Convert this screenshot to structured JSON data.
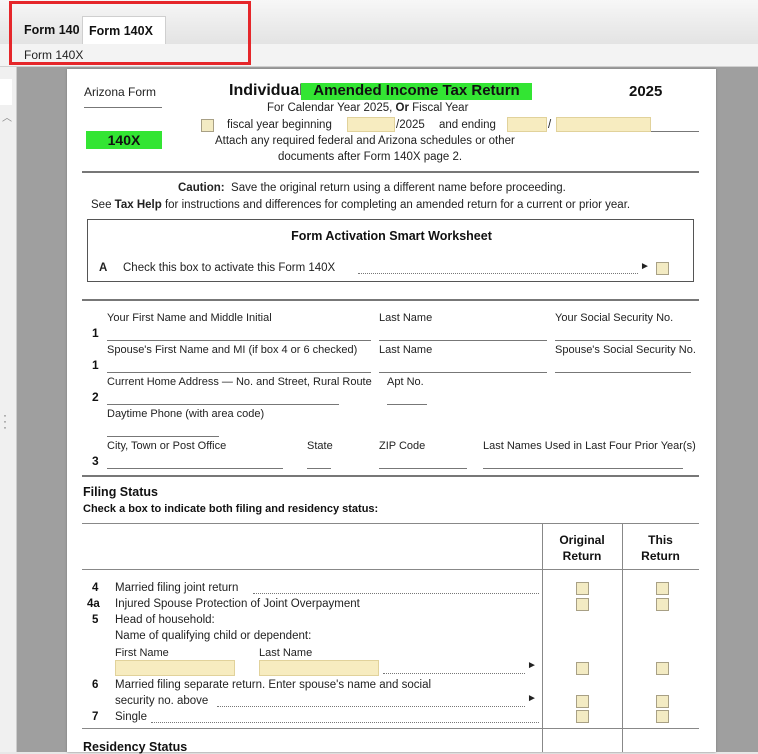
{
  "tabs": [
    "Form 140",
    "Form 140X"
  ],
  "sub_tab": "Form 140X",
  "header": {
    "state_label": "Arizona Form",
    "form_no": "140X",
    "title_prefix": "Individual",
    "title_highlight": "Amended Income Tax Return",
    "year": "2025",
    "calendar_line_1": "For Calendar Year 2025,",
    "calendar_or": "Or",
    "calendar_line_2": "Fiscal Year",
    "fiscal_begin": "fiscal year beginning",
    "fiscal_year_suffix": "/2025",
    "fiscal_ending": "and ending",
    "slash": "/",
    "attach_line1": "Attach any required federal and Arizona schedules or other",
    "attach_line2": "documents after Form 140X page 2."
  },
  "caution": {
    "label": "Caution:",
    "text": "Save the original return using a different name before proceeding.",
    "line2_pre": "See",
    "line2_bold": "Tax Help",
    "line2_post": "for instructions and differences for completing an amended return for a current or prior year."
  },
  "worksheet": {
    "title": "Form Activation Smart Worksheet",
    "line_letter": "A",
    "line_text": "Check this box to activate this Form 140X",
    "arrow": "►"
  },
  "name_section": {
    "row1_no": "1",
    "first_name": "Your First Name and Middle Initial",
    "last_name": "Last Name",
    "ssn": "Your Social Security No.",
    "row1b_no": "1",
    "spouse_first": "Spouse's First Name and MI (if box 4 or 6 checked)",
    "spouse_last": "Last Name",
    "spouse_ssn": "Spouse's Social Security No.",
    "row2_no": "2",
    "address": "Current Home Address — No. and Street, Rural Route",
    "apt": "Apt No.",
    "phone": "Daytime Phone (with area code)",
    "row3_no": "3",
    "city": "City, Town or Post Office",
    "state": "State",
    "zip": "ZIP Code",
    "prior_names": "Last Names Used in Last Four Prior Year(s)"
  },
  "filing_status": {
    "heading": "Filing Status",
    "subheading": "Check a box to indicate both filing and residency status:",
    "col_original_1": "Original",
    "col_original_2": "Return",
    "col_this_1": "This",
    "col_this_2": "Return",
    "lines": [
      {
        "no": "4",
        "text": "Married filing joint return"
      },
      {
        "no": "4a",
        "text": "Injured Spouse Protection of Joint Overpayment"
      },
      {
        "no": "5",
        "text": "Head of household:"
      },
      {
        "no": "",
        "text": "Name of qualifying child or dependent:"
      },
      {
        "no": "6",
        "text": "Married filing separate return. Enter spouse's name and social"
      },
      {
        "no": "",
        "text": "security no. above"
      },
      {
        "no": "7",
        "text": "Single"
      }
    ],
    "first_name": "First Name",
    "last_name": "Last Name"
  },
  "residency": {
    "heading": "Residency Status"
  }
}
